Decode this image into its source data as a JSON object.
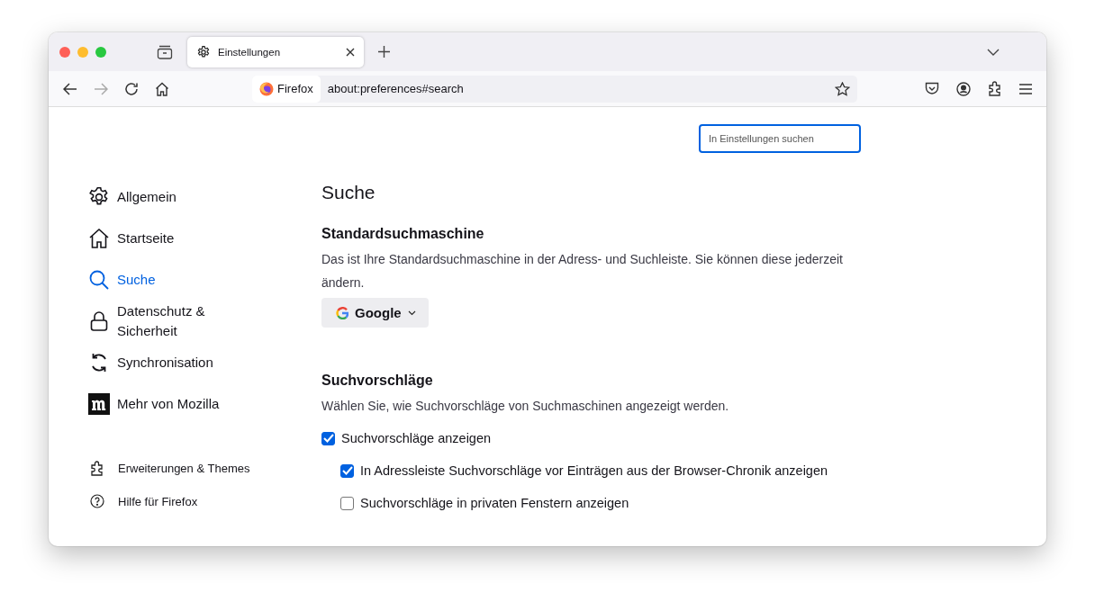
{
  "tabs": [
    {
      "label": "Einstellungen",
      "selected": true
    }
  ],
  "address_bar": {
    "identity": "Firefox",
    "url": "about:preferences#search"
  },
  "search": {
    "placeholder": "In Einstellungen suchen"
  },
  "sidebar": {
    "items": [
      {
        "label": "Allgemein",
        "kind": "gear",
        "selected": false
      },
      {
        "label": "Startseite",
        "kind": "home",
        "selected": false
      },
      {
        "label": "Suche",
        "kind": "search",
        "selected": true
      },
      {
        "label": "Datenschutz & Sicherheit",
        "kind": "lock",
        "selected": false
      },
      {
        "label": "Synchronisation",
        "kind": "sync",
        "selected": false
      },
      {
        "label": "Mehr von Mozilla",
        "kind": "mozilla",
        "selected": false
      }
    ],
    "footer_links": [
      {
        "label": "Erweiterungen & Themes",
        "kind": "puzzle"
      },
      {
        "label": "Hilfe für Firefox",
        "kind": "help"
      }
    ]
  },
  "main": {
    "title": "Suche",
    "default_engine": {
      "heading": "Standardsuchmaschine",
      "description": "Das ist Ihre Standardsuchmaschine in der Adress- und Suchleiste. Sie können diese jederzeit ändern.",
      "dropdown": "Google"
    },
    "suggestions": {
      "heading": "Suchvorschläge",
      "description": "Wählen Sie, wie Suchvorschläge von Suchmaschinen angezeigt werden.",
      "options": [
        {
          "label": "Suchvorschläge anzeigen",
          "checked": true,
          "children": [
            {
              "label": "In Adressleiste Suchvorschläge vor Einträgen aus der Browser-Chronik anzeigen",
              "checked": true
            },
            {
              "label": "Suchvorschläge in privaten Fenstern anzeigen",
              "checked": false
            }
          ]
        }
      ]
    }
  }
}
